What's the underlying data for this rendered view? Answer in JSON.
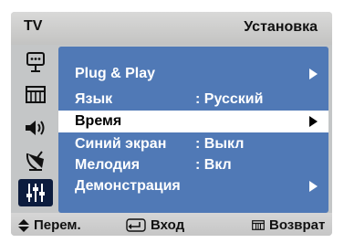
{
  "header": {
    "source": "TV",
    "title": "Установка"
  },
  "sidebar": {
    "items": [
      {
        "icon": "input-source-icon"
      },
      {
        "icon": "picture-icon"
      },
      {
        "icon": "sound-icon"
      },
      {
        "icon": "channel-antenna-icon"
      },
      {
        "icon": "setup-sliders-icon",
        "active": true
      }
    ]
  },
  "menu": {
    "items": [
      {
        "label": "Plug & Play",
        "value": "",
        "has_submenu": true
      },
      {
        "label": "Язык",
        "value": ": Русский",
        "has_submenu": false
      },
      {
        "label": "Время",
        "value": "",
        "has_submenu": true,
        "selected": true
      },
      {
        "label": "Синий экран",
        "value": ":  Выкл",
        "has_submenu": false
      },
      {
        "label": "Мелодия",
        "value": ":  Вкл",
        "has_submenu": false
      },
      {
        "label": "Демонстрация",
        "value": "",
        "has_submenu": true
      }
    ]
  },
  "footer": {
    "move_label": "Перем.",
    "enter_label": "Вход",
    "return_label": "Возврат"
  },
  "colors": {
    "panel": "#5079b6",
    "selected_row": "#ffffff",
    "active_tab": "#0c1c3e",
    "frame": "#c4c6c7"
  }
}
